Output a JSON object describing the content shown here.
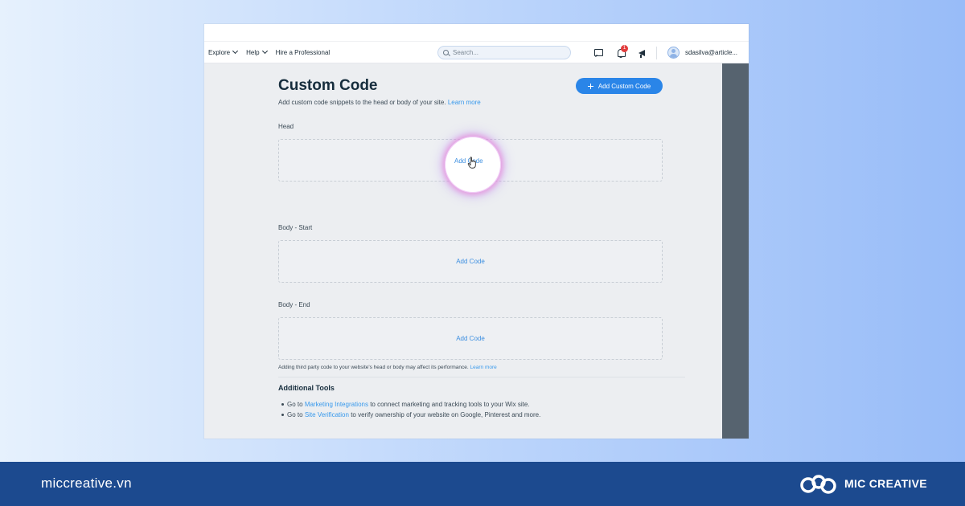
{
  "navbar": {
    "items": [
      "Explore",
      "Help",
      "Hire a Professional"
    ],
    "search_placeholder": "Search...",
    "notification_count": "1",
    "user_email": "sdasilva@article..."
  },
  "page": {
    "title": "Custom Code",
    "description": "Add custom code snippets to the head or body of your site.",
    "description_link": "Learn more",
    "add_button_label": "Add Custom Code"
  },
  "sections": [
    {
      "label": "Head",
      "action": "Add Code"
    },
    {
      "label": "Body - Start",
      "action": "Add Code"
    },
    {
      "label": "Body - End",
      "action": "Add Code"
    }
  ],
  "note": {
    "text": "Adding third party code to your website's head or body may affect its performance.",
    "link": "Learn more"
  },
  "tools": {
    "title": "Additional Tools",
    "items": [
      {
        "prefix": "Go to",
        "link": "Marketing Integrations",
        "suffix": "to connect marketing and tracking tools to your Wix site."
      },
      {
        "prefix": "Go to",
        "link": "Site Verification",
        "suffix": "to verify ownership of your website on Google, Pinterest and more."
      }
    ]
  },
  "footer": {
    "url": "miccreative.vn",
    "brand": "MIC CREATIVE"
  },
  "colors": {
    "accent": "#2a85e8",
    "link": "#3899ec",
    "footer": "#1c4a8f",
    "badge": "#e23d3d"
  }
}
